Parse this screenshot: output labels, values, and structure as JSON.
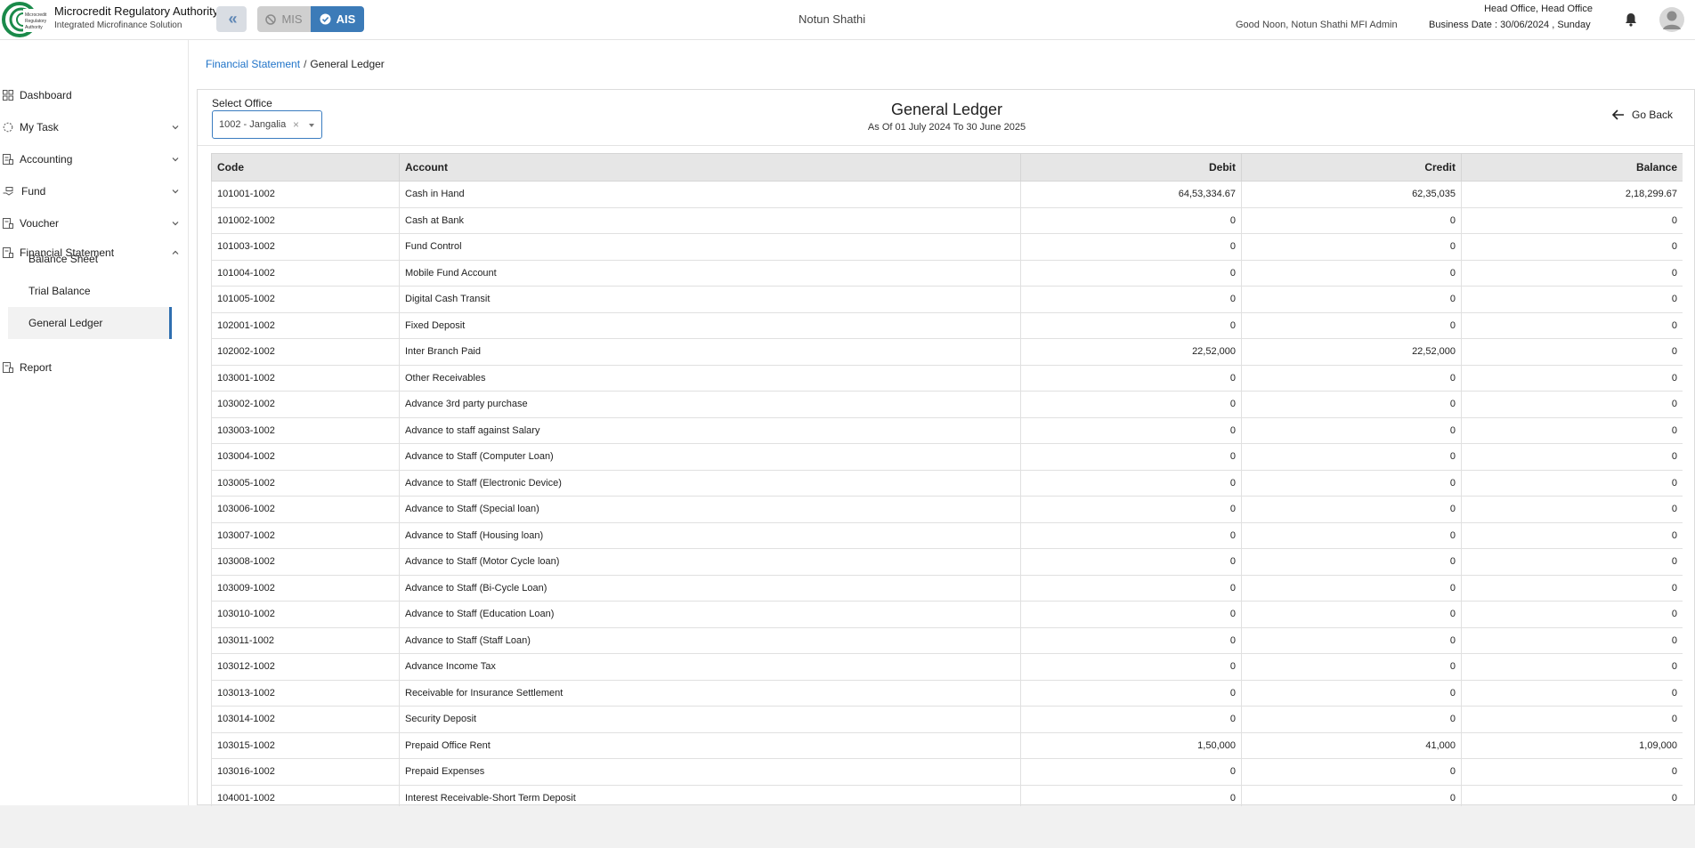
{
  "header": {
    "logo_text": "Microcredit Regulatory Authority",
    "brand_title": "Microcredit Regulatory Authority",
    "brand_subtitle": "Integrated Microfinance Solution",
    "mis_label": "MIS",
    "ais_label": "AIS",
    "org_name": "Notun Shathi",
    "greeting": "Good Noon, Notun Shathi MFI Admin",
    "office": "Head Office, Head Office",
    "business_date": "Business Date : 30/06/2024 , Sunday",
    "colors": {
      "accent": "#3c7bb8",
      "link": "#1f73c8",
      "logo_green": "#1a8a4a"
    }
  },
  "sidebar": {
    "items": [
      {
        "label": "Dashboard",
        "icon": "grid-icon"
      },
      {
        "label": "My Task",
        "icon": "spinner-icon"
      },
      {
        "label": "Accounting",
        "icon": "ledger-icon"
      },
      {
        "label": "Fund",
        "icon": "hand-money-icon"
      },
      {
        "label": "Voucher",
        "icon": "voucher-icon"
      },
      {
        "label": "Financial Statement",
        "icon": "statement-icon"
      },
      {
        "label": "Report",
        "icon": "report-icon"
      }
    ],
    "sub_items": [
      {
        "label": "Balance Sheet"
      },
      {
        "label": "Trial Balance"
      },
      {
        "label": "General Ledger",
        "active": true
      }
    ]
  },
  "breadcrumb": {
    "parent": "Financial Statement",
    "separator": "/",
    "current": "General Ledger"
  },
  "panel": {
    "select_label": "Select Office",
    "select_value": "1002 - Jangalia",
    "title": "General Ledger",
    "subtitle": "As Of 01 July 2024 To 30 June 2025",
    "go_back": "Go Back"
  },
  "table": {
    "columns": [
      "Code",
      "Account",
      "Debit",
      "Credit",
      "Balance"
    ],
    "rows": [
      [
        "101001-1002",
        "Cash in Hand",
        "64,53,334.67",
        "62,35,035",
        "2,18,299.67"
      ],
      [
        "101002-1002",
        "Cash at Bank",
        "0",
        "0",
        "0"
      ],
      [
        "101003-1002",
        "Fund Control",
        "0",
        "0",
        "0"
      ],
      [
        "101004-1002",
        "Mobile Fund Account",
        "0",
        "0",
        "0"
      ],
      [
        "101005-1002",
        "Digital Cash Transit",
        "0",
        "0",
        "0"
      ],
      [
        "102001-1002",
        "Fixed Deposit",
        "0",
        "0",
        "0"
      ],
      [
        "102002-1002",
        "Inter Branch Paid",
        "22,52,000",
        "22,52,000",
        "0"
      ],
      [
        "103001-1002",
        "Other Receivables",
        "0",
        "0",
        "0"
      ],
      [
        "103002-1002",
        "Advance 3rd party purchase",
        "0",
        "0",
        "0"
      ],
      [
        "103003-1002",
        "Advance to staff against Salary",
        "0",
        "0",
        "0"
      ],
      [
        "103004-1002",
        "Advance to Staff (Computer Loan)",
        "0",
        "0",
        "0"
      ],
      [
        "103005-1002",
        "Advance to Staff (Electronic Device)",
        "0",
        "0",
        "0"
      ],
      [
        "103006-1002",
        "Advance to Staff (Special loan)",
        "0",
        "0",
        "0"
      ],
      [
        "103007-1002",
        "Advance to Staff (Housing loan)",
        "0",
        "0",
        "0"
      ],
      [
        "103008-1002",
        "Advance to Staff (Motor Cycle loan)",
        "0",
        "0",
        "0"
      ],
      [
        "103009-1002",
        "Advance to Staff (Bi-Cycle Loan)",
        "0",
        "0",
        "0"
      ],
      [
        "103010-1002",
        "Advance to Staff (Education Loan)",
        "0",
        "0",
        "0"
      ],
      [
        "103011-1002",
        "Advance to Staff (Staff Loan)",
        "0",
        "0",
        "0"
      ],
      [
        "103012-1002",
        "Advance Income Tax",
        "0",
        "0",
        "0"
      ],
      [
        "103013-1002",
        "Receivable for Insurance Settlement",
        "0",
        "0",
        "0"
      ],
      [
        "103014-1002",
        "Security Deposit",
        "0",
        "0",
        "0"
      ],
      [
        "103015-1002",
        "Prepaid Office Rent",
        "1,50,000",
        "41,000",
        "1,09,000"
      ],
      [
        "103016-1002",
        "Prepaid Expenses",
        "0",
        "0",
        "0"
      ],
      [
        "104001-1002",
        "Interest Receivable-Short Term Deposit",
        "0",
        "0",
        "0"
      ]
    ]
  }
}
